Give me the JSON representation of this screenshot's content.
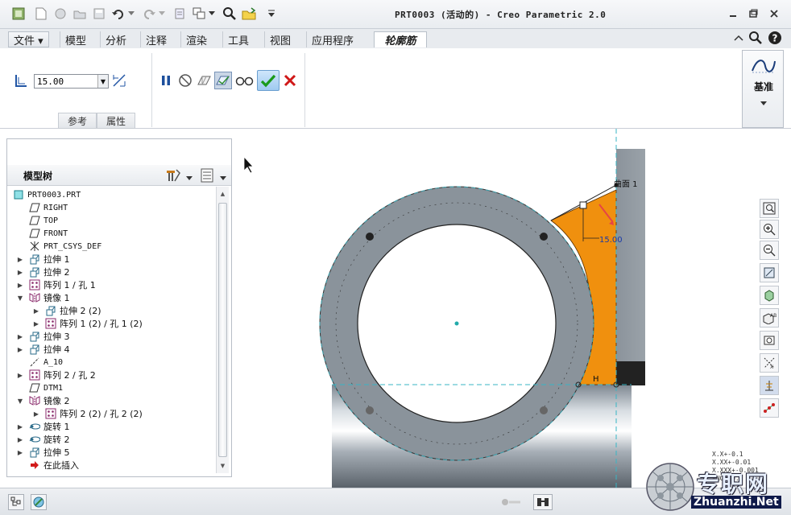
{
  "window": {
    "title": "PRT0003 (活动的) - Creo Parametric 2.0",
    "controls": [
      "minimize-icon",
      "restore-icon",
      "close-icon"
    ]
  },
  "quick_access": [
    "prt-icon",
    "new-icon",
    "open-icon",
    "folder-icon",
    "save-icon",
    "undo-icon",
    "redo-icon",
    "regenerate-icon",
    "windows-icon",
    "zoom-icon",
    "close-window-icon",
    "customize-icon"
  ],
  "tabs": [
    {
      "label": "文件 ▾"
    },
    {
      "label": "模型"
    },
    {
      "label": "分析"
    },
    {
      "label": "注释"
    },
    {
      "label": "渲染"
    },
    {
      "label": "工具"
    },
    {
      "label": "视图"
    },
    {
      "label": "应用程序"
    },
    {
      "label": "轮廓筋"
    }
  ],
  "ribbon": {
    "depth_value": "15.00",
    "references_label": "参考",
    "properties_label": "属性",
    "datum_label": "基准"
  },
  "navigator": {
    "title": "模型树",
    "items": [
      {
        "label": "PRT0003.PRT",
        "indent": 0,
        "expander": "",
        "icon": "part-icon",
        "mono": true
      },
      {
        "label": "RIGHT",
        "indent": 1,
        "expander": "",
        "icon": "datum-plane-icon",
        "mono": true
      },
      {
        "label": "TOP",
        "indent": 1,
        "expander": "",
        "icon": "datum-plane-icon",
        "mono": true
      },
      {
        "label": "FRONT",
        "indent": 1,
        "expander": "",
        "icon": "datum-plane-icon",
        "mono": true
      },
      {
        "label": "PRT_CSYS_DEF",
        "indent": 1,
        "expander": "",
        "icon": "csys-icon",
        "mono": true
      },
      {
        "label": "拉伸 1",
        "indent": 1,
        "expander": "▶",
        "icon": "extrude-icon",
        "mono": false
      },
      {
        "label": "拉伸 2",
        "indent": 1,
        "expander": "▶",
        "icon": "extrude-icon",
        "mono": false
      },
      {
        "label": "阵列 1 / 孔 1",
        "indent": 1,
        "expander": "▶",
        "icon": "pattern-icon",
        "mono": false
      },
      {
        "label": "镜像 1",
        "indent": 1,
        "expander": "▼",
        "icon": "mirror-icon",
        "mono": false
      },
      {
        "label": "拉伸 2 (2)",
        "indent": 2,
        "expander": "▶",
        "icon": "extrude-icon",
        "mono": false
      },
      {
        "label": "阵列 1 (2) / 孔 1 (2)",
        "indent": 2,
        "expander": "▶",
        "icon": "pattern-icon",
        "mono": false
      },
      {
        "label": "拉伸 3",
        "indent": 1,
        "expander": "▶",
        "icon": "extrude-icon",
        "mono": false
      },
      {
        "label": "拉伸 4",
        "indent": 1,
        "expander": "▶",
        "icon": "extrude-icon",
        "mono": false
      },
      {
        "label": "A_10",
        "indent": 1,
        "expander": "",
        "icon": "datum-axis-icon",
        "mono": true
      },
      {
        "label": "阵列 2 / 孔 2",
        "indent": 1,
        "expander": "▶",
        "icon": "pattern-icon",
        "mono": false
      },
      {
        "label": "DTM1",
        "indent": 1,
        "expander": "",
        "icon": "datum-plane-icon",
        "mono": true
      },
      {
        "label": "镜像 2",
        "indent": 1,
        "expander": "▼",
        "icon": "mirror-icon",
        "mono": false
      },
      {
        "label": "阵列 2 (2) / 孔 2 (2)",
        "indent": 2,
        "expander": "▶",
        "icon": "pattern-icon",
        "mono": false
      },
      {
        "label": "旋转 1",
        "indent": 1,
        "expander": "▶",
        "icon": "revolve-icon",
        "mono": false
      },
      {
        "label": "旋转 2",
        "indent": 1,
        "expander": "▶",
        "icon": "revolve-icon",
        "mono": false
      },
      {
        "label": "拉伸 5",
        "indent": 1,
        "expander": "▶",
        "icon": "extrude-icon",
        "mono": false
      },
      {
        "label": "在此插入",
        "indent": 1,
        "expander": "",
        "icon": "insert-arrow-icon",
        "mono": false
      }
    ]
  },
  "canvas": {
    "surface_label": "曲面 1",
    "dimension_value": "15.00",
    "constraint_label": "H"
  },
  "tolerance": [
    "X.X+-0.1",
    "X.XX+-0.01",
    "X.XXX+-0.001",
    "ANG+-0.5"
  ],
  "watermark": {
    "cn": "专职网",
    "en": "Zhuanzhi.Net"
  },
  "colors": {
    "rib_orange": "#f0900e",
    "part_gray": "#8a939b",
    "accept_green": "#1a9a1a",
    "cancel_red": "#d01818"
  }
}
